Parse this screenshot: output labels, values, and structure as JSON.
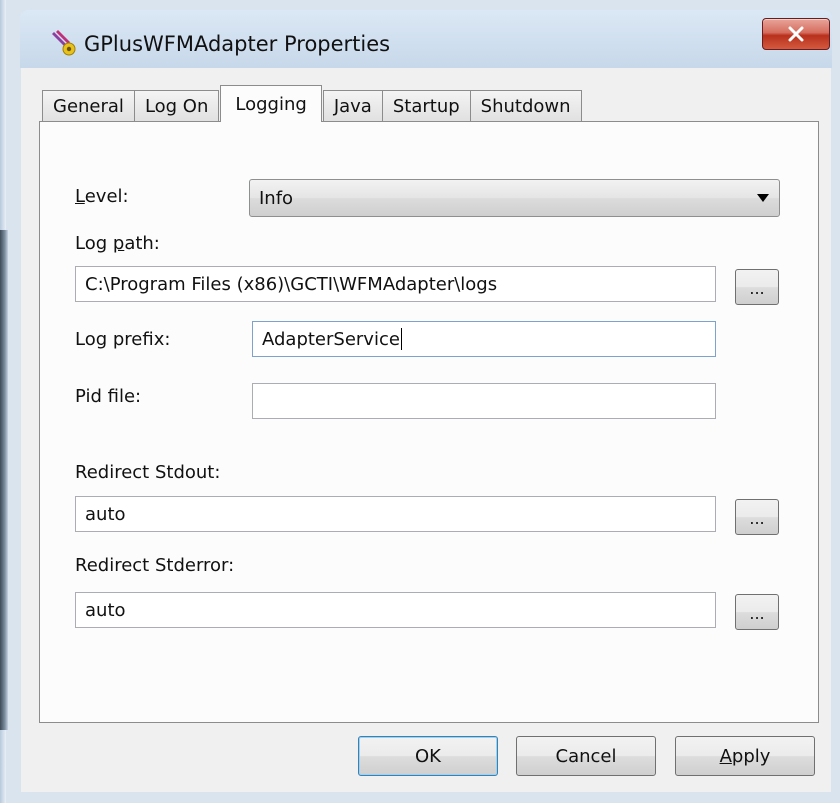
{
  "window": {
    "title": "GPlusWFMAdapter Properties",
    "close_icon": "close-icon"
  },
  "tabs": [
    {
      "label": "General"
    },
    {
      "label": "Log On"
    },
    {
      "label": "Logging"
    },
    {
      "label": "Java"
    },
    {
      "label": "Startup"
    },
    {
      "label": "Shutdown"
    }
  ],
  "active_tab": "Logging",
  "form": {
    "level": {
      "label_pre": "",
      "label_accel": "L",
      "label_post": "evel:",
      "value": "Info"
    },
    "log_path": {
      "label_pre": "Log ",
      "label_accel": "p",
      "label_post": "ath:",
      "value": "C:\\Program Files (x86)\\GCTI\\WFMAdapter\\logs"
    },
    "log_prefix": {
      "label": "Log prefix:",
      "value": "AdapterService"
    },
    "pid_file": {
      "label": "Pid file:",
      "value": ""
    },
    "redirect_stdout": {
      "label": "Redirect Stdout:",
      "value": "auto"
    },
    "redirect_stderror": {
      "label": "Redirect Stderror:",
      "value": "auto"
    },
    "browse_label": "..."
  },
  "buttons": {
    "ok": "OK",
    "cancel": "Cancel",
    "apply_accel": "A",
    "apply_rest": "pply"
  },
  "colors": {
    "close_button": "#c9402b",
    "titlebar": "#d4e2f1",
    "panel": "#fcfcfc"
  }
}
